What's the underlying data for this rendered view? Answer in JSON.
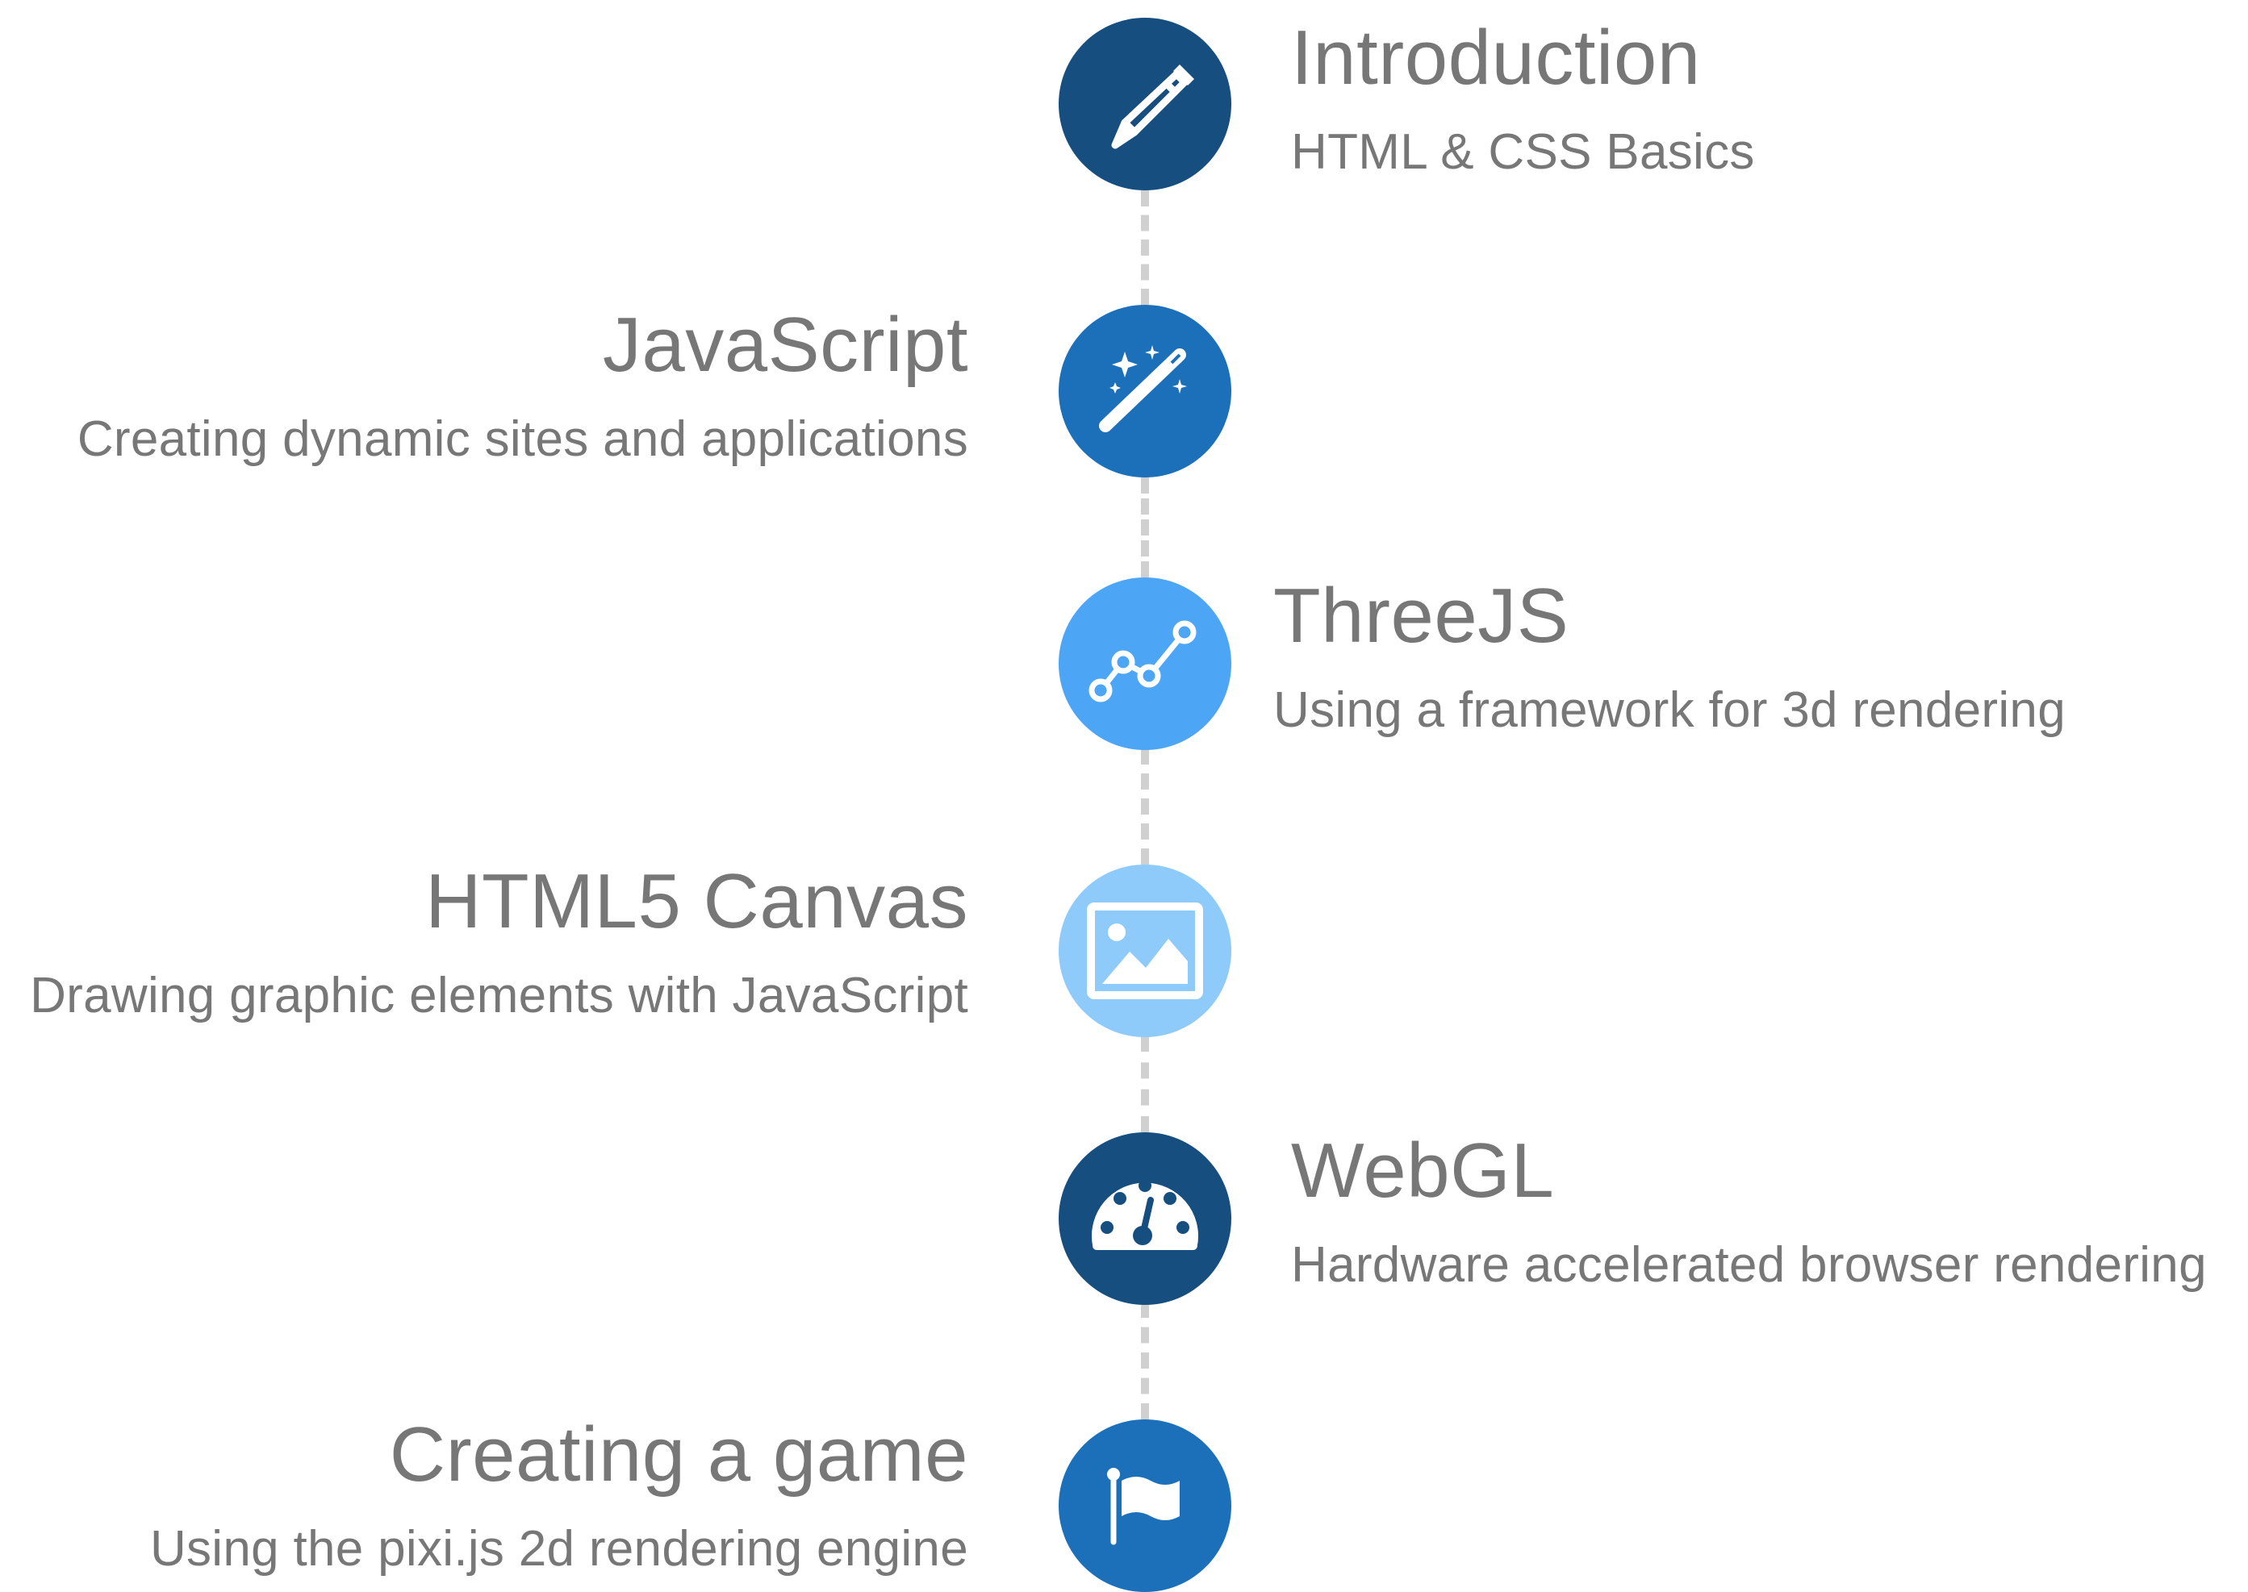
{
  "timeline": {
    "milestones": [
      {
        "title": "Introduction",
        "subtitle": "HTML & CSS Basics",
        "side": "right",
        "icon": "pencil-icon",
        "color": "#164e80"
      },
      {
        "title": "JavaScript",
        "subtitle": "Creating dynamic sites and applications",
        "side": "left",
        "icon": "magic-wand-icon",
        "color": "#1b70b9"
      },
      {
        "title": "ThreeJS",
        "subtitle": "Using a framework for 3d rendering",
        "side": "right",
        "icon": "graph-nodes-icon",
        "color": "#4da6f5"
      },
      {
        "title": "HTML5 Canvas",
        "subtitle": "Drawing graphic elements with JavaScript",
        "side": "left",
        "icon": "image-icon",
        "color": "#8ecbfb"
      },
      {
        "title": "WebGL",
        "subtitle": "Hardware accelerated browser rendering",
        "side": "right",
        "icon": "speedometer-icon",
        "color": "#164e80"
      },
      {
        "title": "Creating a game",
        "subtitle": "Using the pixi.js 2d rendering engine",
        "side": "left",
        "icon": "flag-icon",
        "color": "#1b70b9"
      }
    ],
    "connector_color": "#d0d0d0",
    "text_color": "#777777"
  }
}
